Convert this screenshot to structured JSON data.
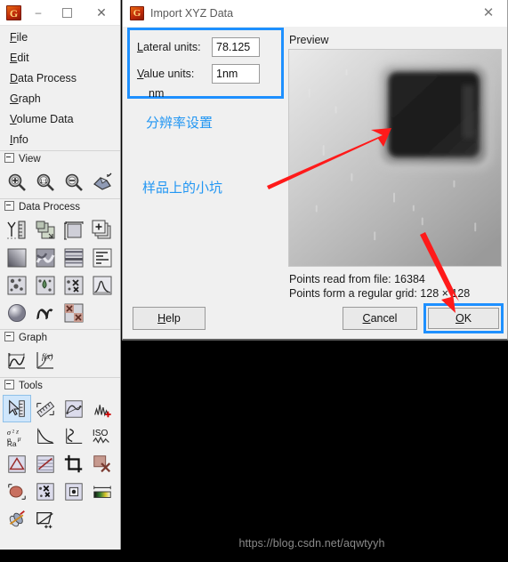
{
  "toolbox": {
    "window_buttons": {
      "minimize": "–",
      "maximize": "□",
      "close": "✕"
    },
    "app_icon": "G",
    "menu": [
      {
        "label": "File",
        "accel": "F"
      },
      {
        "label": "Edit",
        "accel": "E"
      },
      {
        "label": "Data Process",
        "accel": "D"
      },
      {
        "label": "Graph",
        "accel": "G"
      },
      {
        "label": "Volume Data",
        "accel": "V"
      },
      {
        "label": "Info",
        "accel": "I"
      }
    ],
    "sections": [
      {
        "title": "View",
        "icons": [
          "zoom-in-icon",
          "zoom-1to1-icon",
          "zoom-out-icon",
          "3d-view-icon"
        ]
      },
      {
        "title": "Data Process",
        "icons": [
          "scale-icon",
          "crop-data-icon",
          "resample-icon",
          "arithmetic-icon",
          "level-plane-icon",
          "rough-surface-icon",
          "line-correct-icon",
          "row-align-icon",
          "grain-mark-icon",
          "grain-water-icon",
          "grain-remove-icon",
          "grain-dist-icon",
          "sphere-revolve-icon",
          "wave-filter-icon",
          "mask-remove-icon"
        ]
      },
      {
        "title": "Graph",
        "icons": [
          "graph-extract-icon",
          "graph-function-icon"
        ]
      },
      {
        "title": "Tools",
        "selected_index": 0,
        "icons": [
          "read-value-icon",
          "measure-distance-icon",
          "profile-icon",
          "spectra-icon",
          "statistics-icon",
          "stat-quantities-icon",
          "line-stats-icon",
          "iso-roughness-icon",
          "three-point-level-icon",
          "path-level-icon",
          "crop-icon",
          "mask-edit-icon",
          "grain-measure-icon",
          "grain-remove-tool-icon",
          "spot-remove-icon",
          "color-range-icon",
          "filter-icon",
          "selection-manager-icon"
        ]
      }
    ]
  },
  "dialog": {
    "icon": "G",
    "title": "Import XYZ Data",
    "close_label": "✕",
    "fields": [
      {
        "label": "Lateral units:",
        "accel": "L",
        "value": "78.125",
        "unit": ""
      },
      {
        "label": "Value units:",
        "accel": "V",
        "value": "1nm",
        "unit": "nm"
      }
    ],
    "preview_label": "Preview",
    "status": {
      "points_read": "Points read from file: 16384",
      "grid": "Points form a regular grid: 128 × 128"
    },
    "buttons": {
      "help": "Help",
      "help_accel": "H",
      "cancel": "Cancel",
      "cancel_accel": "C",
      "ok": "OK",
      "ok_accel": "O"
    }
  },
  "annotations": {
    "resolution_note": "分辨率设置",
    "pit_note": "样品上的小坑",
    "highlight_color": "#1e90ff",
    "arrow_color": "#ff1a1a",
    "text_color": "#2196f3"
  },
  "watermark": {
    "text": "https://blog.csdn.net/aqwtyyh"
  }
}
